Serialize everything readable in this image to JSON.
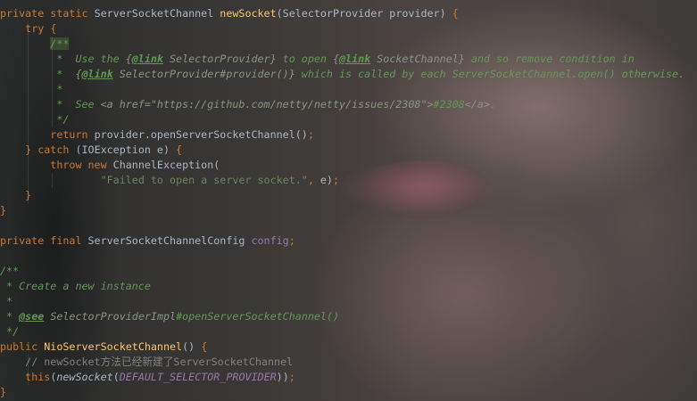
{
  "editor": {
    "theme_colors": {
      "keyword": "#cc7832",
      "method": "#ffc66d",
      "field": "#9876aa",
      "string": "#6a8759",
      "javadoc": "#629755",
      "line_comment": "#808080",
      "default": "#a9b7c6"
    },
    "lines": [
      [
        [
          "kw",
          "private static "
        ],
        [
          "id",
          "ServerSocketChannel "
        ],
        [
          "fn",
          "newSocket"
        ],
        [
          "id",
          "(SelectorProvider provider) "
        ],
        [
          "kw",
          "{"
        ]
      ],
      [
        [
          "id",
          "    "
        ],
        [
          "kw",
          "try "
        ],
        [
          "kw",
          "{"
        ]
      ],
      [
        [
          "id",
          "        "
        ],
        [
          "cm",
          "/**"
        ]
      ],
      [
        [
          "cm",
          "         *  Use the "
        ],
        [
          "cmlink",
          "{"
        ],
        [
          "cmtag",
          "@link"
        ],
        [
          "cmlink",
          " SelectorProvider}"
        ],
        [
          "cm",
          " to open "
        ],
        [
          "cmlink",
          "{"
        ],
        [
          "cmtag",
          "@link"
        ],
        [
          "cmlink",
          " SocketChannel}"
        ],
        [
          "cm",
          " and so remove condition in"
        ]
      ],
      [
        [
          "cm",
          "         *  "
        ],
        [
          "cmlink",
          "{"
        ],
        [
          "cmtag",
          "@link"
        ],
        [
          "cmlink",
          " SelectorProvider#provider()}"
        ],
        [
          "cm",
          " which is called by each ServerSocketChannel.open() otherwise."
        ]
      ],
      [
        [
          "cm",
          "         *"
        ]
      ],
      [
        [
          "cm",
          "         *  See "
        ],
        [
          "cmlink",
          "<a href=\"https://github.com/netty/netty/issues/2308\">"
        ],
        [
          "cm",
          "#2308"
        ],
        [
          "cmlink",
          "</a>"
        ],
        [
          "cm",
          "."
        ]
      ],
      [
        [
          "cm",
          "         */"
        ]
      ],
      [
        [
          "id",
          "        "
        ],
        [
          "kw",
          "return "
        ],
        [
          "id",
          "provider.openServerSocketChannel()"
        ],
        [
          "kw",
          ";"
        ]
      ],
      [
        [
          "id",
          "    "
        ],
        [
          "kw",
          "} catch "
        ],
        [
          "id",
          "(IOException e) "
        ],
        [
          "kw",
          "{"
        ]
      ],
      [
        [
          "id",
          "        "
        ],
        [
          "kw",
          "throw new "
        ],
        [
          "id",
          "ChannelException("
        ]
      ],
      [
        [
          "id",
          "                "
        ],
        [
          "str",
          "\"Failed to open a server socket.\""
        ],
        [
          "kw",
          ", "
        ],
        [
          "id",
          "e)"
        ],
        [
          "kw",
          ";"
        ]
      ],
      [
        [
          "id",
          "    "
        ],
        [
          "kw",
          "}"
        ]
      ],
      [
        [
          "kw",
          "}"
        ]
      ],
      [
        [
          "id",
          ""
        ]
      ],
      [
        [
          "kw",
          "private final "
        ],
        [
          "id",
          "ServerSocketChannelConfig "
        ],
        [
          "fld",
          "config"
        ],
        [
          "kw",
          ";"
        ]
      ],
      [
        [
          "id",
          ""
        ]
      ],
      [
        [
          "cm",
          "/**"
        ]
      ],
      [
        [
          "cm",
          " * Create a new instance"
        ]
      ],
      [
        [
          "cm",
          " *"
        ]
      ],
      [
        [
          "cm",
          " * "
        ],
        [
          "cmtag",
          "@see"
        ],
        [
          "cmlink",
          " SelectorProviderImpl"
        ],
        [
          "cm",
          "#openServerSocketChannel()"
        ]
      ],
      [
        [
          "cm",
          " */"
        ]
      ],
      [
        [
          "kw",
          "public "
        ],
        [
          "fn",
          "NioServerSocketChannel"
        ],
        [
          "id",
          "() "
        ],
        [
          "kw",
          "{"
        ]
      ],
      [
        [
          "id",
          "    "
        ],
        [
          "lc",
          "// newSocket方法已经新建了ServerSocketChannel"
        ]
      ],
      [
        [
          "id",
          "    "
        ],
        [
          "kw",
          "this"
        ],
        [
          "id",
          "("
        ],
        [
          "mcall",
          "newSocket"
        ],
        [
          "id",
          "("
        ],
        [
          "fldi",
          "DEFAULT_SELECTOR_PROVIDER"
        ],
        [
          "id",
          "))"
        ],
        [
          "kw",
          ";"
        ]
      ],
      [
        [
          "kw",
          "}"
        ]
      ]
    ]
  }
}
